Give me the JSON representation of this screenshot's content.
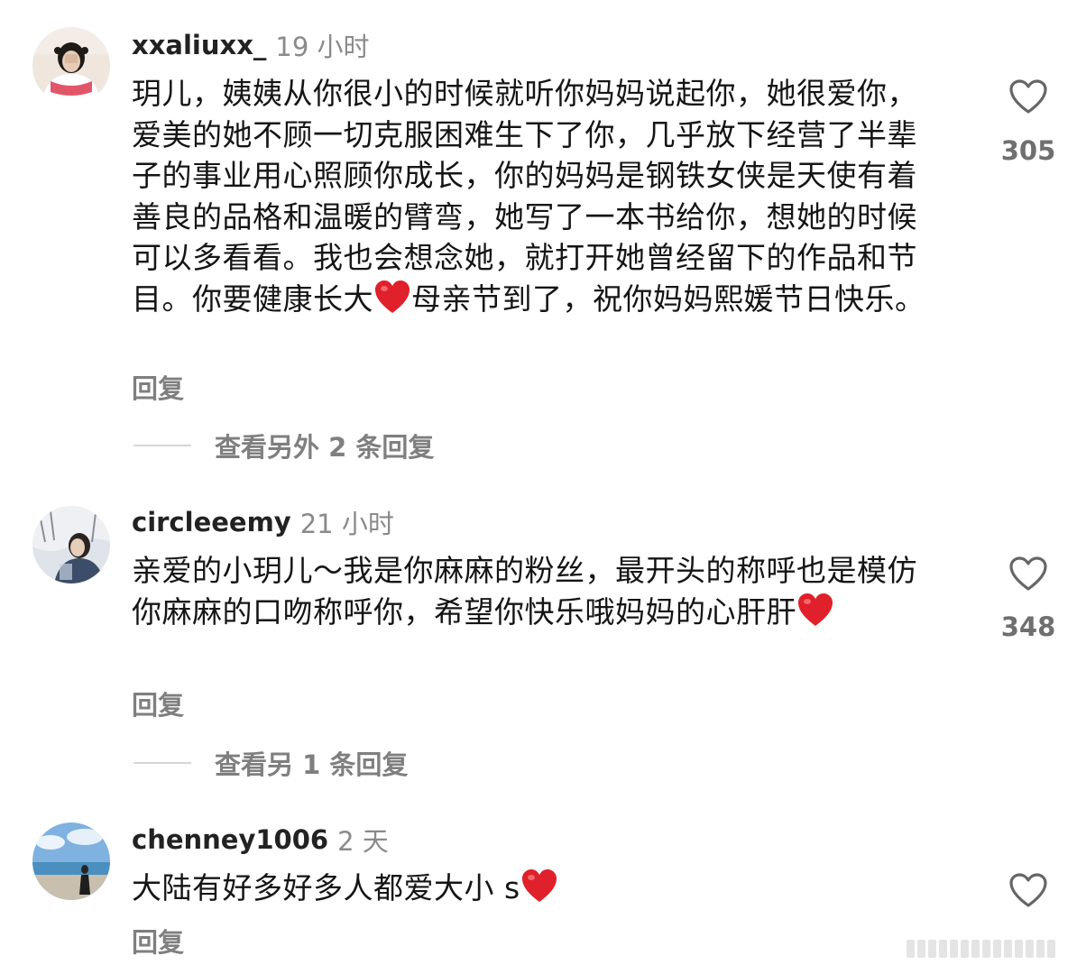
{
  "comments": [
    {
      "username": "xxaliuxx_",
      "time": "19 小时",
      "text": "玥儿，姨姨从你很小的时候就听你妈妈说起你，她很爱你，爱美的她不顾一切克服困难生下了你，几乎放下经营了半辈子的事业用心照顾你成长，你的妈妈是钢铁女侠是天使有着善良的品格和温暖的臂弯，她写了一本书给你，想她的时候可以多看看。我也会想念她，就打开她曾经留下的作品和节目。你要健康长大",
      "emoji": "red-heart",
      "text_after": "母亲节到了，祝你妈妈熙媛节日快乐。",
      "reply_label": "回复",
      "view_replies": "查看另外 2 条回复",
      "likes": "305"
    },
    {
      "username": "circleeemy",
      "time": "21 小时",
      "text": "亲爱的小玥儿～我是你麻麻的粉丝，最开头的称呼也是模仿你麻麻的口吻称呼你，希望你快乐哦妈妈的心肝肝",
      "emoji": "red-heart",
      "reply_label": "回复",
      "view_replies": "查看另 1 条回复",
      "likes": "348"
    },
    {
      "username": "chenney1006",
      "time": "2 天",
      "text": "大陆有好多好多人都爱大小 s",
      "emoji": "red-heart",
      "reply_label": "回复",
      "likes": ""
    }
  ],
  "icons": {
    "like": "heart-outline-icon",
    "emoji": "red-heart-emoji"
  },
  "colors": {
    "username": "#222222",
    "meta_gray": "#8a8a8a",
    "heart_red": "#e0202a"
  }
}
